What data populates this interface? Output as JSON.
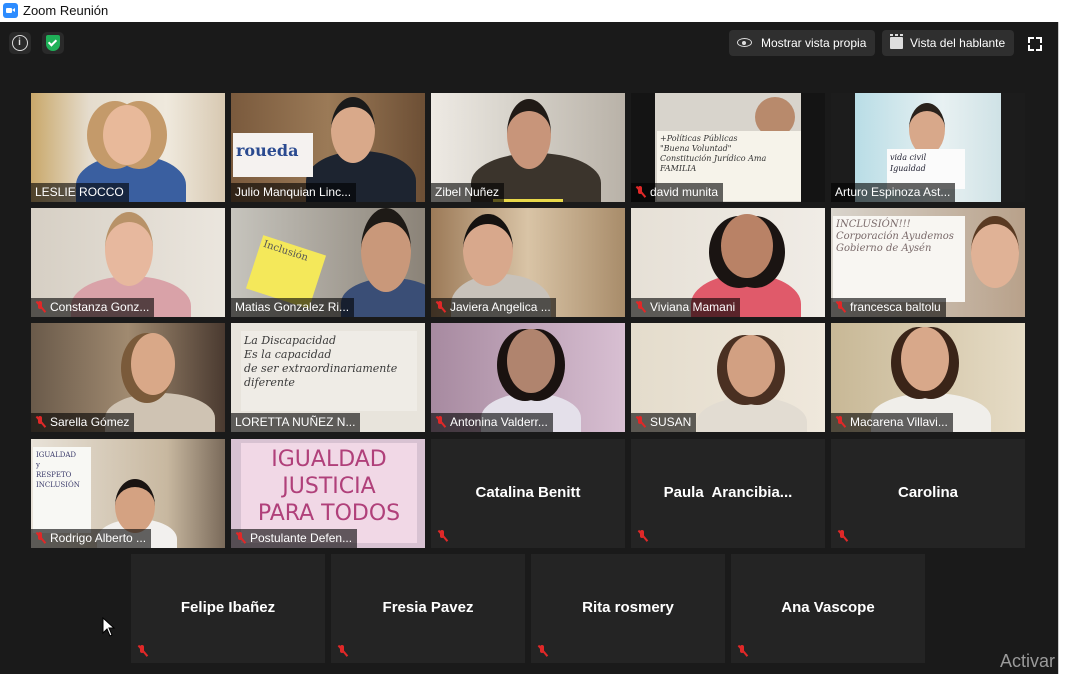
{
  "window": {
    "title": "Zoom Reunión"
  },
  "toolbar": {
    "self_view_label": "Mostrar vista propia",
    "speaker_view_label": "Vista del hablante"
  },
  "video_participants": [
    {
      "name": "LESLIE ROCCO",
      "muted": false
    },
    {
      "name": "Julio Manquian Linc...",
      "muted": false,
      "sign": "roueda"
    },
    {
      "name": "Zibel Nuñez",
      "muted": false
    },
    {
      "name": "david munita",
      "muted": true,
      "sign": "+Políticas Públicas\n\"Buena Voluntad\"\nConstitución Jurídico Ama\nFAMILIA"
    },
    {
      "name": "Arturo Espinoza Ast...",
      "muted": false,
      "sign": "vida civil\nIgualdad"
    },
    {
      "name": "Constanza Gonz...",
      "muted": true
    },
    {
      "name": "Matias Gonzalez Ri...",
      "muted": false,
      "sign": "Inclusión"
    },
    {
      "name": "Javiera Angelica ...",
      "muted": true
    },
    {
      "name": "Viviana Mamani",
      "muted": true
    },
    {
      "name": "francesca baltolu",
      "muted": true,
      "sign": "INCLUSIÓN!!!\nCorporación Ayudemos\nGobierno de Aysén"
    },
    {
      "name": "Sarella Gómez",
      "muted": true
    },
    {
      "name": "LORETTA NUÑEZ N...",
      "muted": false,
      "sign": "La Discapacidad\nEs la capacidad\nde ser extraordinariamente\ndiferente"
    },
    {
      "name": "Antonina Valderr...",
      "muted": true
    },
    {
      "name": "SUSAN",
      "muted": true
    },
    {
      "name": "Macarena Villavi...",
      "muted": true
    },
    {
      "name": "Rodrigo Alberto ...",
      "muted": true,
      "sign": "IGUALDAD\ny\nRESPETO\nINCLUSIÓN"
    },
    {
      "name": "Postulante Defen...",
      "muted": true,
      "sign": "IGUALDAD\nJUSTICIA\nPARA TODOS"
    }
  ],
  "audio_participants": [
    {
      "name": "Catalina Benitt"
    },
    {
      "name": "Paula  Arancibia..."
    },
    {
      "name": "Carolina"
    },
    {
      "name": "Felipe Ibañez"
    },
    {
      "name": "Fresia Pavez"
    },
    {
      "name": "Rita rosmery"
    },
    {
      "name": "Ana Vascope"
    }
  ],
  "watermark": "Activar",
  "icons": [
    "zoom-app-icon",
    "info-icon",
    "shield-icon",
    "eye-icon",
    "grid-icon",
    "fullscreen-icon",
    "mic-muted-icon",
    "mouse-cursor"
  ],
  "colors": {
    "background": "#1a1a1a",
    "muted": "#e02828",
    "shield": "#1fb158",
    "zoom_blue": "#2d8cff"
  }
}
